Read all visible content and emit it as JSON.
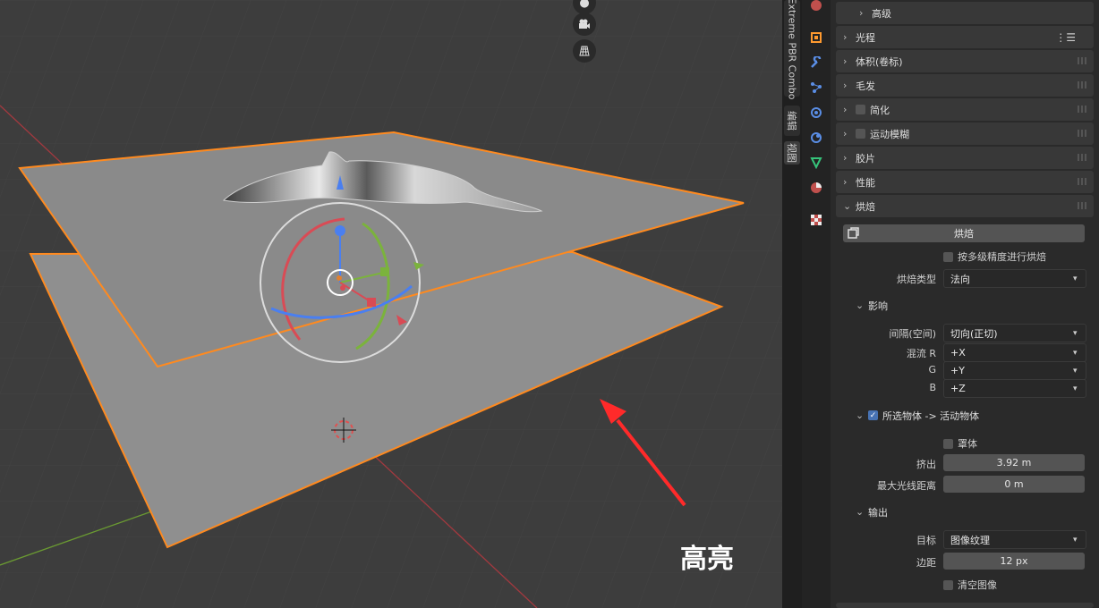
{
  "viewport": {
    "annotation": "高亮",
    "nav_icons": [
      "camera-icon",
      "grid-icon"
    ]
  },
  "ntabs": {
    "addon": "Extreme PBR Combo",
    "edit": "编辑",
    "view": "视图"
  },
  "sections": {
    "advanced": "高级",
    "light_paths": "光程",
    "volumes": "体积(卷标)",
    "hair": "毛发",
    "simplify": "简化",
    "motion_blur": "运动模糊",
    "film": "胶片",
    "performance": "性能",
    "bake": "烘焙",
    "influence": "影响",
    "selected_to_active": "所选物体 -> 活动物体",
    "output": "输出"
  },
  "bake": {
    "button": "烘焙",
    "multires": "按多级精度进行烘焙",
    "type_label": "烘焙类型",
    "type_value": "法向"
  },
  "influence": {
    "space_label": "间隔(空间)",
    "space_value": "切向(正切)",
    "swizzle_r_label": "混流 R",
    "swizzle_r_value": "+X",
    "g_label": "G",
    "g_value": "+Y",
    "b_label": "B",
    "b_value": "+Z"
  },
  "selected": {
    "checked": true,
    "cage": "罩体",
    "extrusion_label": "挤出",
    "extrusion_value": "3.92 m",
    "max_ray_label": "最大光线距离",
    "max_ray_value": "0 m"
  },
  "output": {
    "target_label": "目标",
    "target_value": "图像纹理",
    "margin_label": "边距",
    "margin_value": "12 px",
    "clear": "清空图像"
  },
  "colors": {
    "selection_outline": "#ff8a1f",
    "x_axis": "#d94b55",
    "y_axis": "#7bb33c",
    "z_axis": "#4a7ff0",
    "checkbox_on": "#4772b3",
    "annotation_arrow": "#ff2a2a"
  }
}
